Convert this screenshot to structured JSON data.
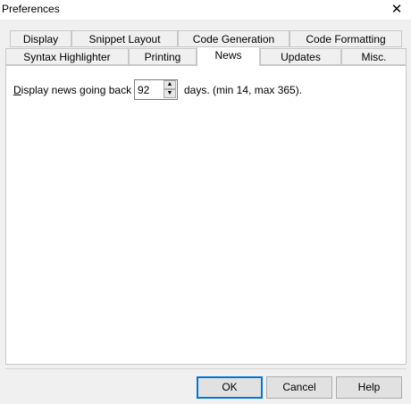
{
  "window": {
    "title": "Preferences",
    "close_symbol": "✕"
  },
  "tabs": {
    "row1": [
      "Display",
      "Snippet Layout",
      "Code Generation",
      "Code Formatting"
    ],
    "row2": [
      "Syntax Highlighter",
      "Printing",
      "News",
      "Updates",
      "Misc."
    ],
    "active": "News"
  },
  "news": {
    "label_accel": "D",
    "label_rest": "isplay news going back",
    "days_value": "92",
    "range_text": "days. (min 14, max 365)."
  },
  "buttons": {
    "ok": "OK",
    "cancel": "Cancel",
    "help": "Help"
  },
  "icons": {
    "close": "close-icon",
    "spin_up": "spin-up-arrow-icon",
    "spin_down": "spin-down-arrow-icon"
  }
}
